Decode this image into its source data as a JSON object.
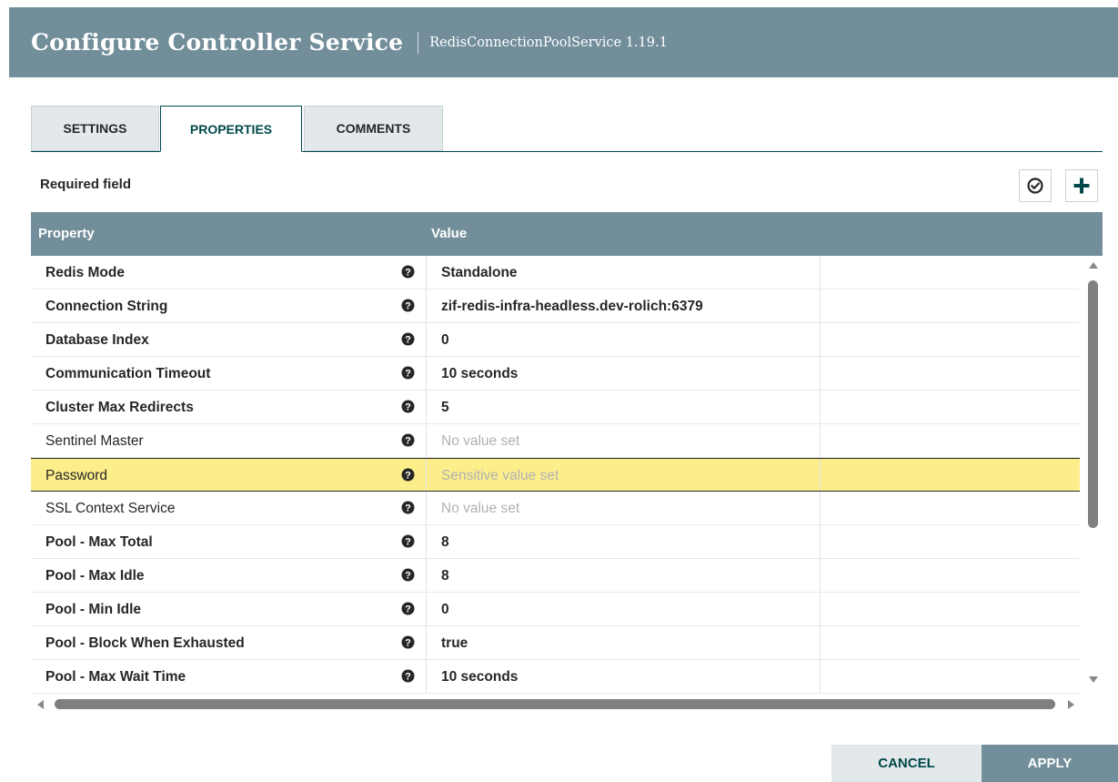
{
  "dialog": {
    "title": "Configure Controller Service",
    "subtitle": "RedisConnectionPoolService 1.19.1"
  },
  "tabs": [
    {
      "label": "SETTINGS",
      "active": false
    },
    {
      "label": "PROPERTIES",
      "active": true
    },
    {
      "label": "COMMENTS",
      "active": false
    }
  ],
  "toolbar": {
    "required_label": "Required field",
    "verify_icon": "check-circle-icon",
    "add_icon": "plus-icon"
  },
  "table": {
    "headers": {
      "property": "Property",
      "value": "Value"
    },
    "rows": [
      {
        "name": "Redis Mode",
        "value": "Standalone",
        "required": true,
        "value_set": true
      },
      {
        "name": "Connection String",
        "value": "zif-redis-infra-headless.dev-rolich:6379",
        "required": true,
        "value_set": true
      },
      {
        "name": "Database Index",
        "value": "0",
        "required": true,
        "value_set": true
      },
      {
        "name": "Communication Timeout",
        "value": "10 seconds",
        "required": true,
        "value_set": true
      },
      {
        "name": "Cluster Max Redirects",
        "value": "5",
        "required": true,
        "value_set": true
      },
      {
        "name": "Sentinel Master",
        "value": "No value set",
        "required": false,
        "value_set": false
      },
      {
        "name": "Password",
        "value": "Sensitive value set",
        "required": false,
        "value_set": false,
        "selected": true
      },
      {
        "name": "SSL Context Service",
        "value": "No value set",
        "required": false,
        "value_set": false
      },
      {
        "name": "Pool - Max Total",
        "value": "8",
        "required": true,
        "value_set": true
      },
      {
        "name": "Pool - Max Idle",
        "value": "8",
        "required": true,
        "value_set": true
      },
      {
        "name": "Pool - Min Idle",
        "value": "0",
        "required": true,
        "value_set": true
      },
      {
        "name": "Pool - Block When Exhausted",
        "value": "true",
        "required": true,
        "value_set": true
      },
      {
        "name": "Pool - Max Wait Time",
        "value": "10 seconds",
        "required": true,
        "value_set": true
      }
    ]
  },
  "buttons": {
    "cancel": "CANCEL",
    "apply": "APPLY"
  },
  "colors": {
    "header_bg": "#728e9b",
    "accent": "#004849",
    "selected_row": "#fdee8c",
    "placeholder_text": "#b1b1b1"
  }
}
